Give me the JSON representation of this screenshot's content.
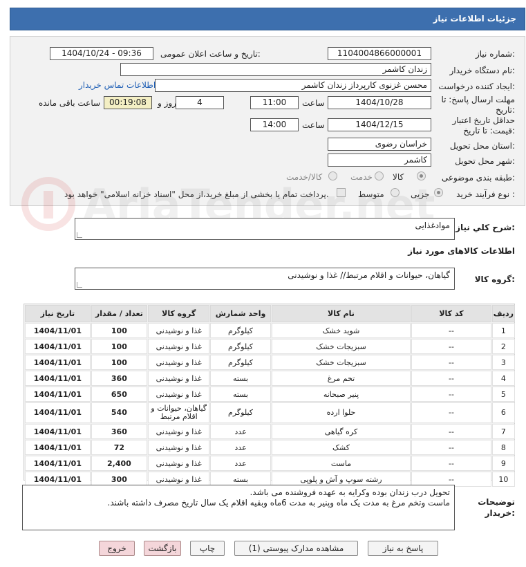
{
  "header": {
    "title": "جزئیات اطلاعات نیاز"
  },
  "form": {
    "need_number_label": "شماره نیاز:",
    "need_number": "1104004866000001",
    "announce_label": "تاریخ و ساعت اعلان عمومی:",
    "announce_value": "1404/10/24 - 09:36",
    "buyer_org_label": "نام دستگاه خریدار:",
    "buyer_org": "زندان کاشمر",
    "creator_label": "ایجاد کننده درخواست:",
    "creator": "محسن غزنوی کارپرداز زندان کاشمر",
    "contact_link": "اطلاعات تماس خریدار",
    "deadline_label": "مهلت ارسال پاسخ: تا تاریخ:",
    "deadline_date": "1404/10/28",
    "hour_label": "ساعت",
    "deadline_time": "11:00",
    "days": "4",
    "days_label": "روز و",
    "remaining_time": "00:19:08",
    "remaining_label": "ساعت باقی مانده",
    "validity_label": "حداقل تاریخ اعتبار قیمت: تا تاریخ:",
    "validity_date": "1404/12/15",
    "validity_time": "14:00",
    "province_label": "استان محل تحویل:",
    "province": "خراسان رضوی",
    "city_label": "شهر محل تحویل:",
    "city": "کاشمر",
    "category_label": "طبقه بندی موضوعی:",
    "category_options": [
      "کالا",
      "خدمت",
      "کالا/خدمت"
    ],
    "process_label": "نوع فرآیند خرید :",
    "process_options": [
      "جزیی",
      "متوسط"
    ],
    "treasury_note": "پرداخت تمام یا بخشی از مبلغ خرید،از محل \"اسناد خزانه اسلامی\" خواهد بود."
  },
  "summary": {
    "label": "شرح کلي نياز:",
    "value": "موادغذایی",
    "goods_info_label": "اطلاعات کالاهای مورد نیاز",
    "group_label": "گروه کالا:",
    "group_value": "گیاهان، حیوانات و اقلام مرتبط// غذا و نوشیدنی"
  },
  "table": {
    "headers": [
      "ردیف",
      "کد کالا",
      "نام کالا",
      "واحد شمارش",
      "گروه کالا",
      "تعداد / مقدار",
      "تاریخ نیاز"
    ],
    "rows": [
      [
        "1",
        "--",
        "شوید خشک",
        "کیلوگرم",
        "غذا و نوشیدنی",
        "100",
        "1404/11/01"
      ],
      [
        "2",
        "--",
        "سبزیجات خشک",
        "کیلوگرم",
        "غذا و نوشیدنی",
        "100",
        "1404/11/01"
      ],
      [
        "3",
        "--",
        "سبزیجات خشک",
        "کیلوگرم",
        "غذا و نوشیدنی",
        "100",
        "1404/11/01"
      ],
      [
        "4",
        "--",
        "تخم مرغ",
        "بسته",
        "غذا و نوشیدنی",
        "360",
        "1404/11/01"
      ],
      [
        "5",
        "--",
        "پنیر صبحانه",
        "بسته",
        "غذا و نوشیدنی",
        "650",
        "1404/11/01"
      ],
      [
        "6",
        "--",
        "حلوا ارده",
        "کیلوگرم",
        "گیاهان، حیوانات و اقلام مرتبط",
        "540",
        "1404/11/01"
      ],
      [
        "7",
        "--",
        "کره گیاهی",
        "عدد",
        "غذا و نوشیدنی",
        "360",
        "1404/11/01"
      ],
      [
        "8",
        "--",
        "کشک",
        "عدد",
        "غذا و نوشیدنی",
        "72",
        "1404/11/01"
      ],
      [
        "9",
        "--",
        "ماست",
        "عدد",
        "غذا و نوشیدنی",
        "2,400",
        "1404/11/01"
      ],
      [
        "10",
        "--",
        "رشته سوپ و آش و پلوپی",
        "بسته",
        "غذا و نوشیدنی",
        "300",
        "1404/11/01"
      ]
    ]
  },
  "notes": {
    "label": "توضیحات خریدار:",
    "line1": "تحویل درب زندان بوده وکرایه به عهده فروشنده می باشد.",
    "line2": "ماست وتخم مرغ به مدت یک ماه وپنیر به مدت 6ماه وبقیه اقلام یک سال تاریخ مصرف داشته باشند."
  },
  "buttons": {
    "reply": "پاسخ به نیاز",
    "docs": "مشاهده مدارک پیوستی (1)",
    "print": "چاپ",
    "back": "بازگشت",
    "exit": "خروج"
  },
  "watermark": {
    "text": "AriaTender.net"
  }
}
